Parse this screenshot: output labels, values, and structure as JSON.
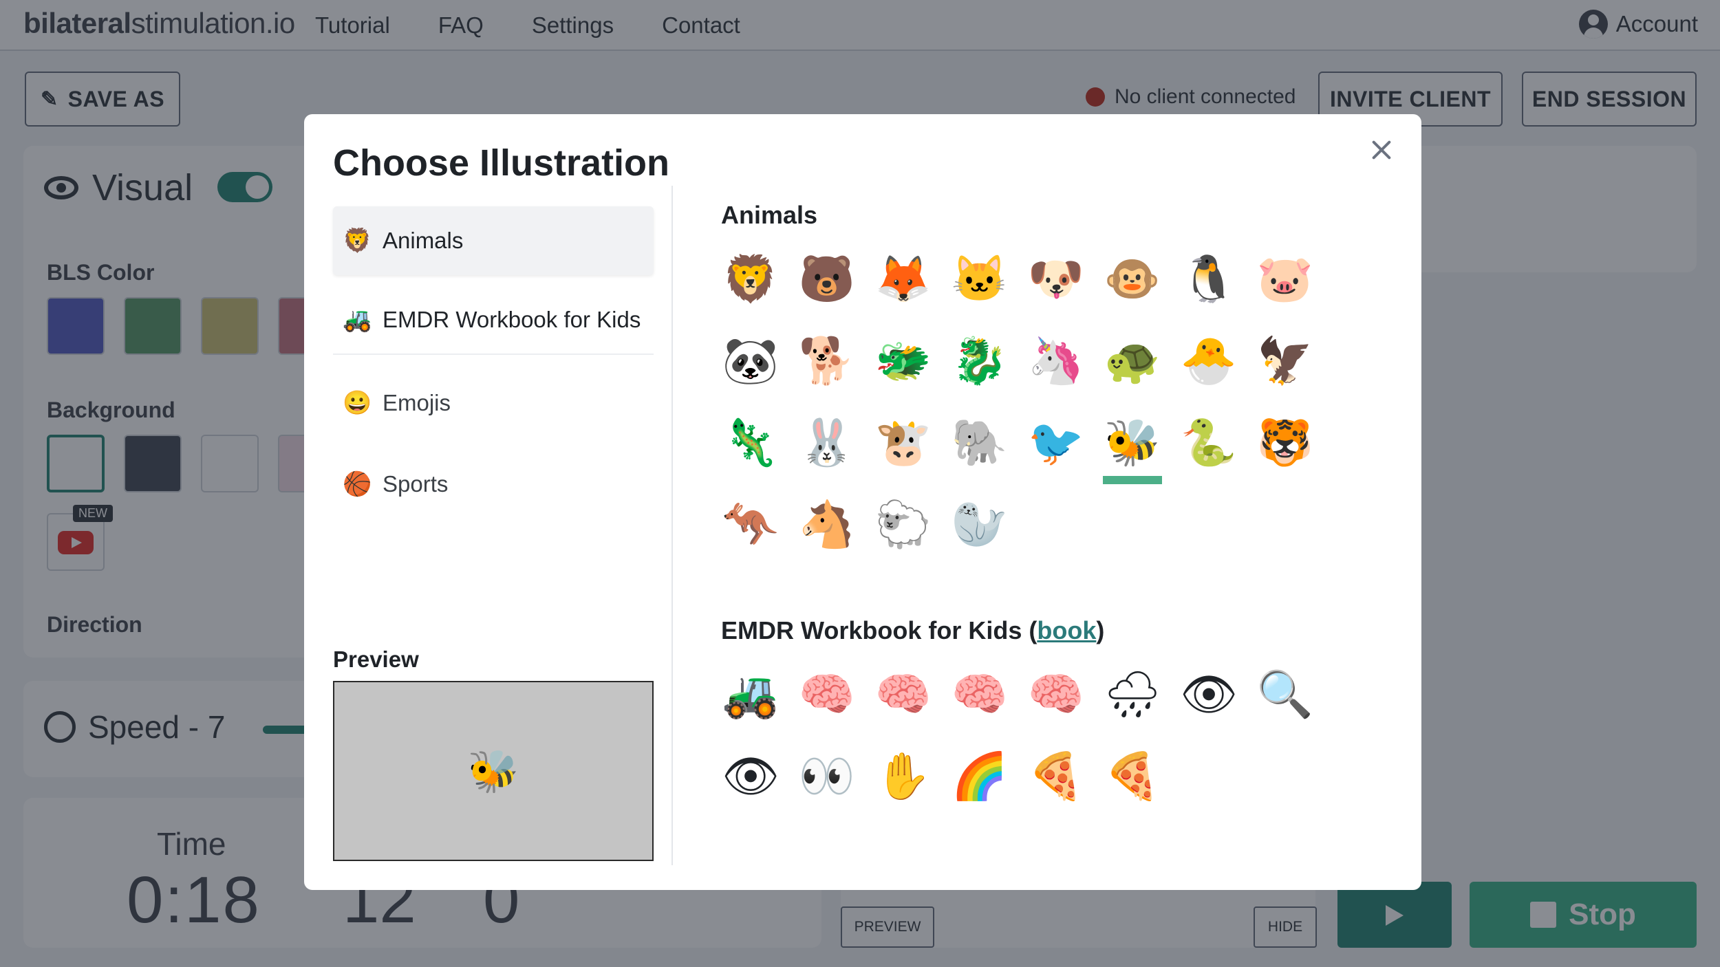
{
  "app": {
    "brand_bold": "bilateral",
    "brand_rest": "stimulation.io",
    "nav": [
      "Tutorial",
      "FAQ",
      "Settings",
      "Contact"
    ],
    "account": "Account",
    "save_as": "SAVE AS",
    "status": "No client connected",
    "invite": "INVITE CLIENT",
    "end": "END SESSION",
    "visual": "Visual",
    "bls_color": "BLS Color",
    "background": "Background",
    "new_badge": "NEW",
    "direction": "Direction",
    "speed": "Speed - 7",
    "time_label": "Time",
    "time_value": "0:18",
    "frag1": "12",
    "frag2": "0",
    "preview_btn": "PREVIEW",
    "hide_btn": "HIDE",
    "stop": "Stop",
    "colors": {
      "bls": [
        "#5b63c4",
        "#5e9c6e",
        "#cdc27a",
        "#c77a86"
      ],
      "bg": [
        "#ffffff",
        "#4b505c",
        "#ffffff",
        "#f2dde6"
      ],
      "accent": "#2e8b7a"
    }
  },
  "modal": {
    "title": "Choose Illustration",
    "categories": [
      {
        "label": "Animals",
        "icon": "lion-icon",
        "glyph": "🦁"
      },
      {
        "label": "EMDR Workbook for Kids",
        "icon": "excavator-icon",
        "glyph": "🚜"
      },
      {
        "label": "Emojis",
        "icon": "smile-icon",
        "glyph": "😀"
      },
      {
        "label": "Sports",
        "icon": "basketball-icon",
        "glyph": "🏀"
      }
    ],
    "preview_label": "Preview",
    "preview_glyph": "🐝",
    "animals_title": "Animals",
    "workbook_title": "EMDR Workbook for Kids (",
    "workbook_link": "book",
    "workbook_close": ")",
    "animals": [
      {
        "icon": "lion-icon",
        "glyph": "🦁"
      },
      {
        "icon": "bear-icon",
        "glyph": "🐻"
      },
      {
        "icon": "fox-icon",
        "glyph": "🦊"
      },
      {
        "icon": "cat-icon",
        "glyph": "🐱"
      },
      {
        "icon": "dog-icon",
        "glyph": "🐶"
      },
      {
        "icon": "monkey-icon",
        "glyph": "🐵"
      },
      {
        "icon": "penguin-icon",
        "glyph": "🐧"
      },
      {
        "icon": "pig-icon",
        "glyph": "🐷"
      },
      {
        "icon": "panda-icon",
        "glyph": "🐼"
      },
      {
        "icon": "shiba-icon",
        "glyph": "🐕"
      },
      {
        "icon": "dragon-icon",
        "glyph": "🐲"
      },
      {
        "icon": "green-dragon-icon",
        "glyph": "🐉"
      },
      {
        "icon": "unicorn-icon",
        "glyph": "🦄"
      },
      {
        "icon": "turtle-icon",
        "glyph": "🐢"
      },
      {
        "icon": "chick-icon",
        "glyph": "🐣"
      },
      {
        "icon": "eagle-icon",
        "glyph": "🦅"
      },
      {
        "icon": "axolotl-icon",
        "glyph": "🦎"
      },
      {
        "icon": "rabbit-icon",
        "glyph": "🐰"
      },
      {
        "icon": "cow-icon",
        "glyph": "🐮"
      },
      {
        "icon": "elephant-icon",
        "glyph": "🐘"
      },
      {
        "icon": "heron-icon",
        "glyph": "🐦"
      },
      {
        "icon": "bee-icon",
        "glyph": "🐝"
      },
      {
        "icon": "snake-icon",
        "glyph": "🐍"
      },
      {
        "icon": "tiger-icon",
        "glyph": "🐯"
      },
      {
        "icon": "kangaroo-icon",
        "glyph": "🦘"
      },
      {
        "icon": "horse-icon",
        "glyph": "🐴"
      },
      {
        "icon": "sheep-icon",
        "glyph": "🐑"
      },
      {
        "icon": "walrus-icon",
        "glyph": "🦭"
      }
    ],
    "selected_animal": 21,
    "workbook": [
      {
        "icon": "excavator-icon",
        "glyph": "🚜"
      },
      {
        "icon": "brain-icon",
        "glyph": "🧠"
      },
      {
        "icon": "brain-icon",
        "glyph": "🧠"
      },
      {
        "icon": "brain-thinking-icon",
        "glyph": "🧠"
      },
      {
        "icon": "brain-icon",
        "glyph": "🧠"
      },
      {
        "icon": "cloud-rain-icon",
        "glyph": "🌧"
      },
      {
        "icon": "eyeball-icon",
        "glyph": "👁"
      },
      {
        "icon": "eye-magnifier-icon",
        "glyph": "🔍"
      },
      {
        "icon": "eyeball-blue-icon",
        "glyph": "👁"
      },
      {
        "icon": "eyeball-brown-icon",
        "glyph": "👀"
      },
      {
        "icon": "hand-icon",
        "glyph": "✋"
      },
      {
        "icon": "rainbow-icon",
        "glyph": "🌈"
      },
      {
        "icon": "pizza-icon",
        "glyph": "🍕"
      },
      {
        "icon": "pizza-slice-icon",
        "glyph": "🍕"
      }
    ]
  }
}
